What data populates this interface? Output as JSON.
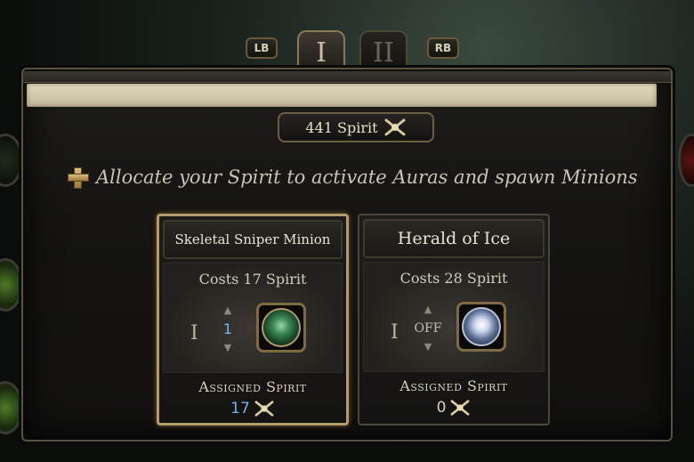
{
  "tabs": {
    "left_hint": "LB",
    "right_hint": "RB",
    "items": [
      {
        "label": "I",
        "active": true
      },
      {
        "label": "II",
        "active": false
      }
    ]
  },
  "spirit": {
    "total_label": "441 Spirit",
    "icon": "spirit-icon"
  },
  "instruction": "Allocate your Spirit to activate Auras and spawn Minions",
  "cards": [
    {
      "title": "Skeletal Sniper Minion",
      "cost": "Costs 17 Spirit",
      "roman": "I",
      "level": "1",
      "gem_icon": "skeletal-sniper-gem-icon",
      "assigned_label": "Assigned Spirit",
      "assigned_value": "17",
      "selected": true
    },
    {
      "title": "Herald of Ice",
      "cost": "Costs 28 Spirit",
      "roman": "I",
      "level": "OFF",
      "gem_icon": "herald-of-ice-gem-icon",
      "assigned_label": "Assigned Spirit",
      "assigned_value": "0",
      "selected": false
    }
  ],
  "colors": {
    "accent_gold": "#b39b6a",
    "active_value_blue": "#7ab0e6"
  }
}
